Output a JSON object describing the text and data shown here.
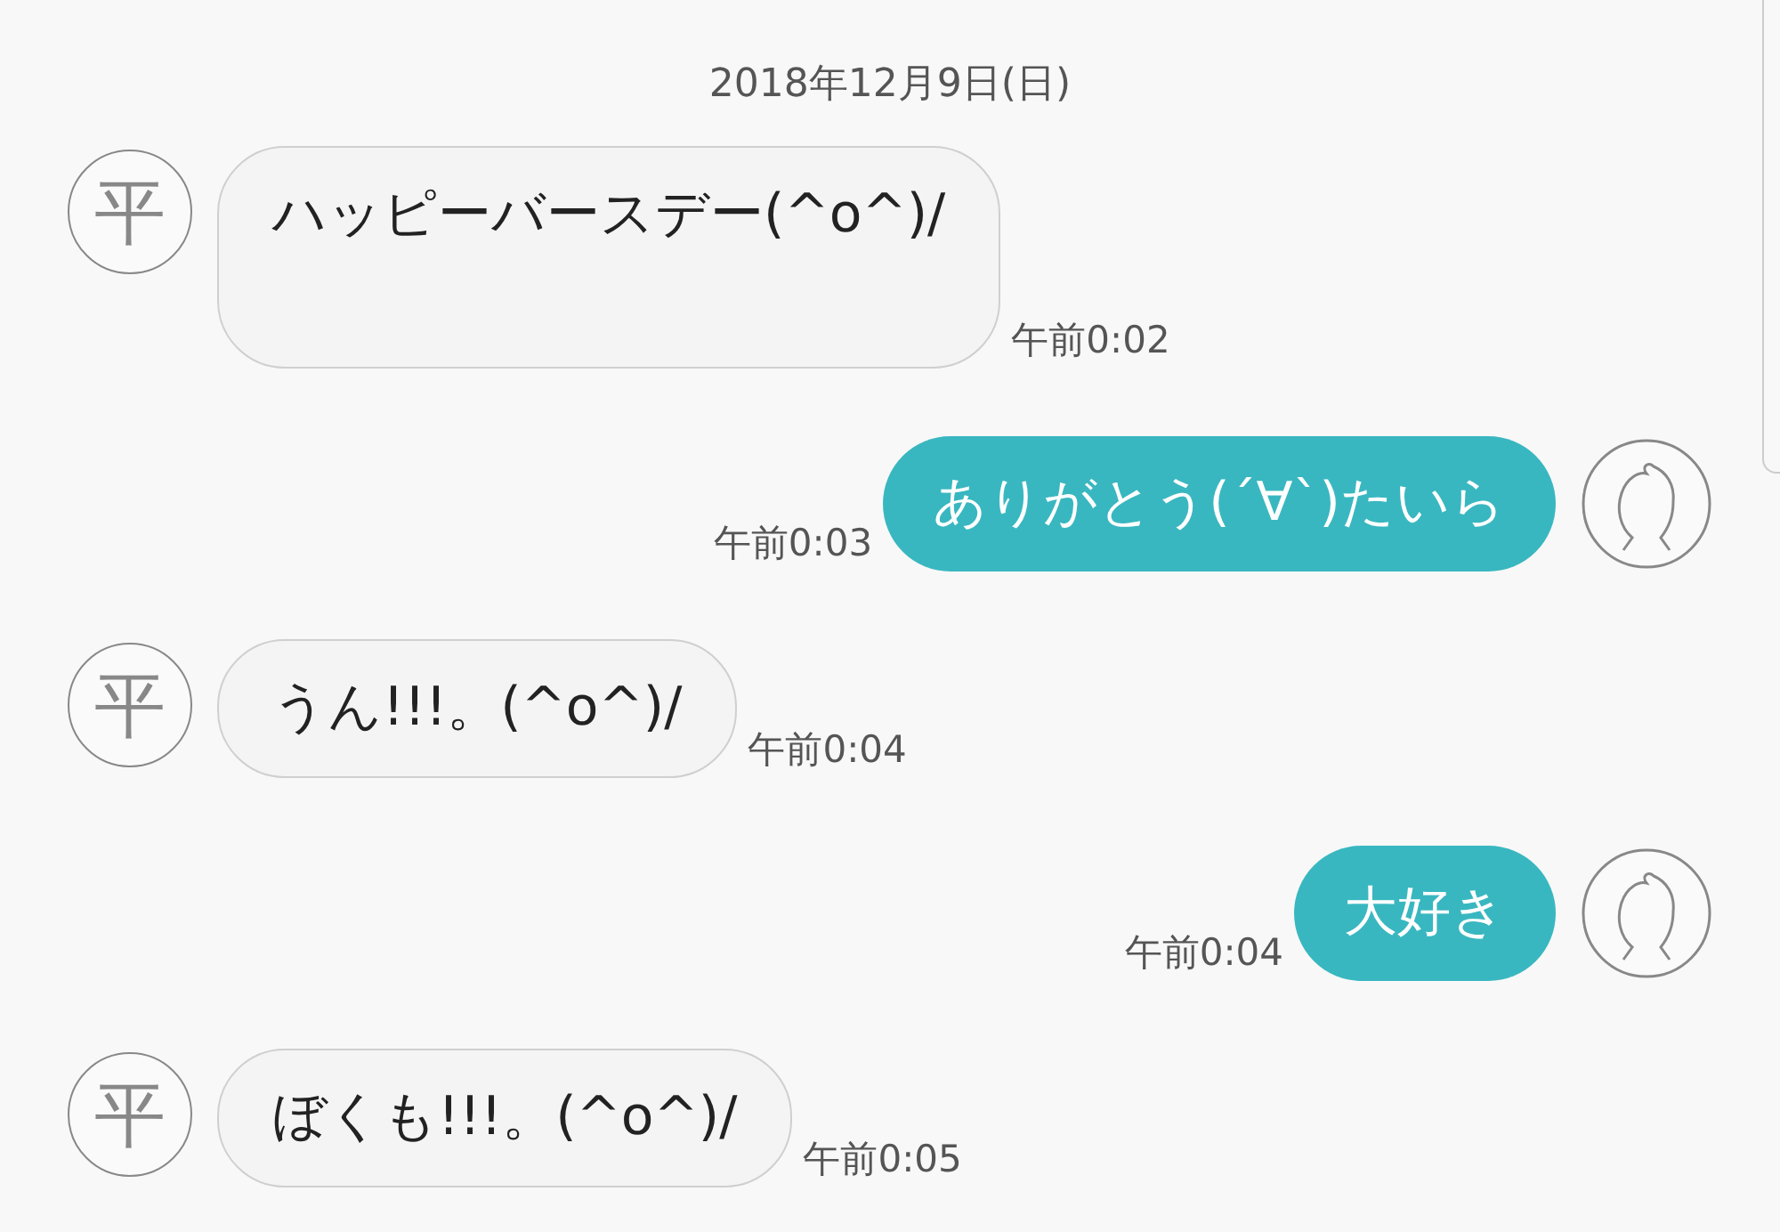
{
  "date_header": "2018年12月9日(日)",
  "messages": [
    {
      "kind": "received",
      "avatar": "平",
      "text": "ハッピーバースデー(^o^)/",
      "time": "午前0:02"
    },
    {
      "kind": "sent",
      "text": "ありがとう(´∀`)たいら",
      "time": "午前0:03"
    },
    {
      "kind": "received",
      "avatar": "平",
      "text": "うん!!!。(^o^)/",
      "time": "午前0:04"
    },
    {
      "kind": "sent",
      "text": "大好き",
      "time": "午前0:04"
    },
    {
      "kind": "received",
      "avatar": "平",
      "text": "ぼくも!!!。(^o^)/",
      "time": "午前0:05"
    }
  ]
}
